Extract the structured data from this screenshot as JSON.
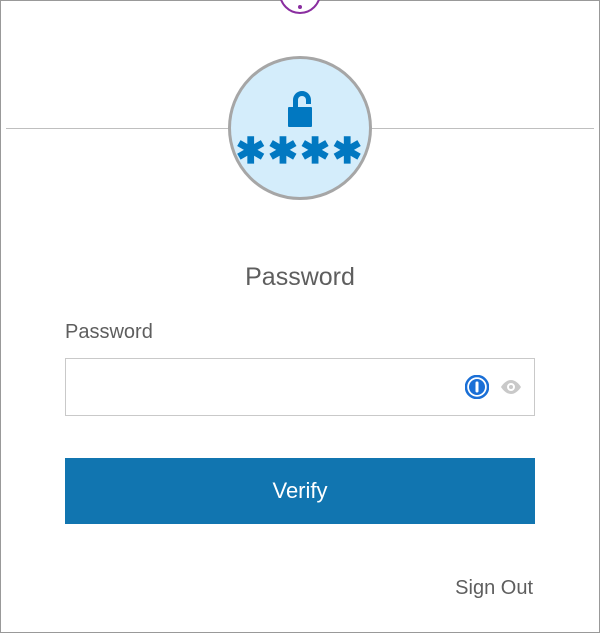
{
  "heading": "Password",
  "form": {
    "password_label": "Password",
    "password_value": "",
    "verify_button_label": "Verify",
    "signout_label": "Sign Out"
  },
  "icons": {
    "lock_stars": "✱✱✱✱"
  },
  "colors": {
    "accent_blue": "#1175b0",
    "circle_bg": "#d4edfb",
    "icon_blue": "#0178c1",
    "border_gray": "#a6a6a6",
    "text_gray": "#5e5e5e",
    "purple": "#8a2ea0"
  }
}
